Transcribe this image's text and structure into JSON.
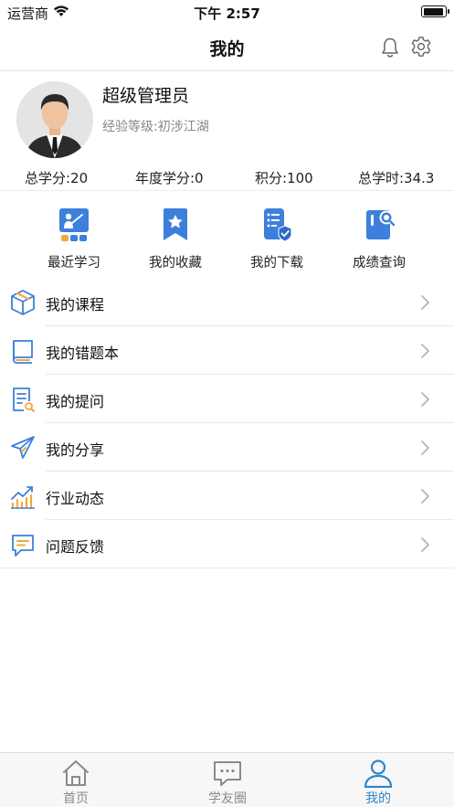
{
  "status_bar": {
    "carrier": "运营商",
    "time": "下午 2:57",
    "battery_level": 0.8
  },
  "nav": {
    "title": "我的"
  },
  "profile": {
    "name": "超级管理员",
    "level": "经验等级:初涉江湖"
  },
  "stats": [
    "总学分:20",
    "年度学分:0",
    "积分:100",
    "总学时:34.3"
  ],
  "quick_actions": [
    {
      "label": "最近学习",
      "icon": "teaching-screen-icon"
    },
    {
      "label": "我的收藏",
      "icon": "bookmark-star-icon"
    },
    {
      "label": "我的下载",
      "icon": "download-checklist-icon"
    },
    {
      "label": "成绩查询",
      "icon": "grade-search-icon"
    }
  ],
  "menu": [
    {
      "label": "我的课程",
      "icon": "course-box-icon"
    },
    {
      "label": "我的错题本",
      "icon": "notebook-icon"
    },
    {
      "label": "我的提问",
      "icon": "question-document-icon"
    },
    {
      "label": "我的分享",
      "icon": "paper-plane-icon"
    },
    {
      "label": "行业动态",
      "icon": "trend-chart-icon"
    },
    {
      "label": "问题反馈",
      "icon": "feedback-chat-icon"
    }
  ],
  "tabs": [
    {
      "label": "首页",
      "icon": "home-icon",
      "active": false
    },
    {
      "label": "学友圈",
      "icon": "chat-bubble-icon",
      "active": false
    },
    {
      "label": "我的",
      "icon": "person-icon",
      "active": true
    }
  ],
  "colors": {
    "accent": "#2e86c9",
    "icon_blue": "#3d7fdc",
    "icon_orange": "#f2a93b"
  }
}
